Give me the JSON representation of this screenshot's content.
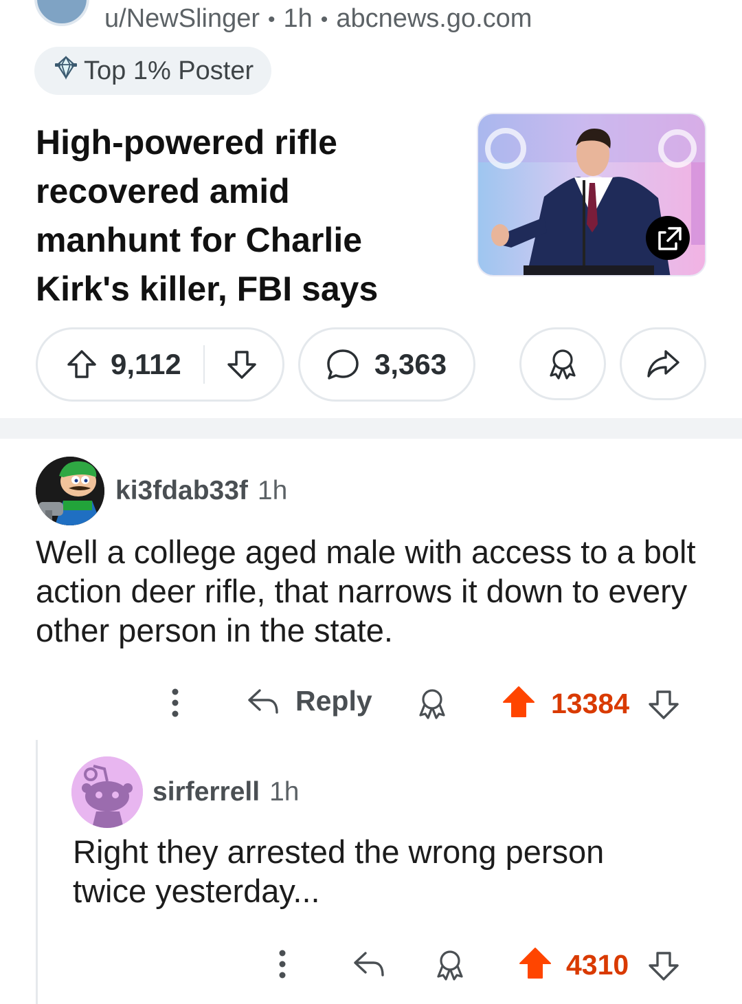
{
  "post": {
    "author": "u/NewSlinger",
    "time": "1h",
    "domain": "abcnews.go.com",
    "flair": "Top 1% Poster",
    "title": "High-powered rifle recovered amid manhunt for Charlie Kirk's killer, FBI says",
    "upvotes": "9,112",
    "comments": "3,363"
  },
  "comments": [
    {
      "username": "ki3fdab33f",
      "time": "1h",
      "text": "Well a college aged male with access to a bolt action deer rifle, that narrows it down to every other person in the state.",
      "reply_label": "Reply",
      "score": "13384"
    },
    {
      "username": "sirferrell",
      "time": "1h",
      "text": "Right they arrested the wrong person twice yesterday...",
      "score": "4310"
    }
  ],
  "colors": {
    "upvote_active": "#ff4500",
    "score_active": "#d93a00",
    "muted_text": "#5c6266",
    "pill_border": "#e4e8ec"
  },
  "icons": [
    "upvote-icon",
    "downvote-icon",
    "comment-icon",
    "award-icon",
    "share-icon",
    "external-link-icon",
    "more-icon",
    "reply-icon"
  ]
}
